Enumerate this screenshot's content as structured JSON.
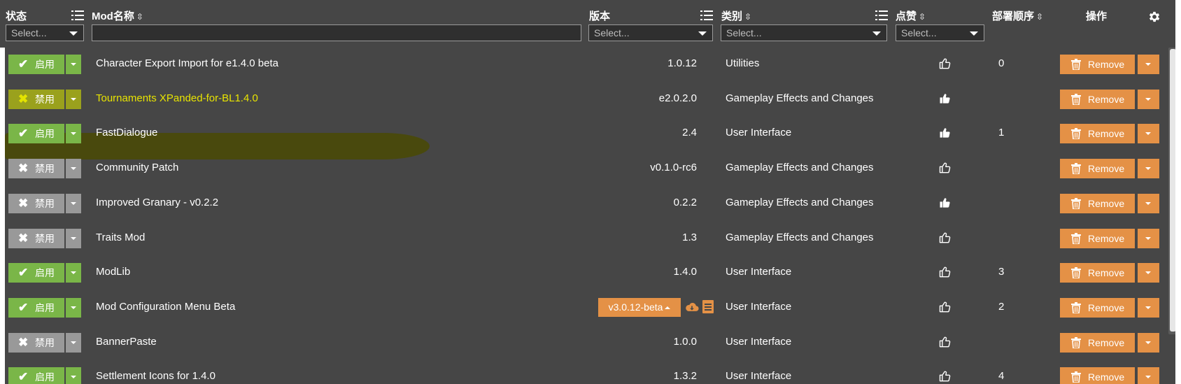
{
  "header": {
    "status": "状态",
    "name": "Mod名称",
    "version": "版本",
    "category": "类别",
    "likes": "点赞",
    "deploy_order": "部署顺序",
    "actions": "操作"
  },
  "filters": {
    "status": "Select...",
    "version": "Select...",
    "category": "Select...",
    "likes": "Select..."
  },
  "status_labels": {
    "enabled": "启用",
    "disabled": "禁用"
  },
  "remove_label": "Remove",
  "rows": [
    {
      "enabled": true,
      "name": "Character Export Import for e1.4.0 beta",
      "version": "1.0.12",
      "category": "Utilities",
      "liked": false,
      "order": "0"
    },
    {
      "enabled": false,
      "name": "Tournaments XPanded-for-BL1.4.0",
      "version": "e2.0.2.0",
      "category": "Gameplay Effects and Changes",
      "liked": true,
      "order": ""
    },
    {
      "enabled": true,
      "name": "FastDialogue",
      "version": "2.4",
      "category": "User Interface",
      "liked": true,
      "order": "1"
    },
    {
      "enabled": false,
      "name": "Community Patch",
      "version": "v0.1.0-rc6",
      "category": "Gameplay Effects and Changes",
      "liked": false,
      "order": ""
    },
    {
      "enabled": false,
      "name": "Improved Granary - v0.2.2",
      "version": "0.2.2",
      "category": "Gameplay Effects and Changes",
      "liked": true,
      "order": ""
    },
    {
      "enabled": false,
      "name": "Traits Mod",
      "version": "1.3",
      "category": "Gameplay Effects and Changes",
      "liked": false,
      "order": ""
    },
    {
      "enabled": true,
      "name": "ModLib",
      "version": "1.4.0",
      "category": "User Interface",
      "liked": false,
      "order": "3"
    },
    {
      "enabled": true,
      "name": "Mod Configuration Menu Beta",
      "version": "v3.0.12-beta",
      "category": "User Interface",
      "liked": false,
      "order": "2",
      "update_available": true
    },
    {
      "enabled": false,
      "name": "BannerPaste",
      "version": "1.0.0",
      "category": "User Interface",
      "liked": false,
      "order": ""
    },
    {
      "enabled": true,
      "name": "Settlement Icons for 1.4.0",
      "version": "1.3.2",
      "category": "User Interface",
      "liked": false,
      "order": "4"
    }
  ],
  "colors": {
    "background": "#464646",
    "enabled": "#7ab648",
    "disabled": "#999999",
    "remove": "#e49146",
    "highlight": "#4a4a0b"
  }
}
